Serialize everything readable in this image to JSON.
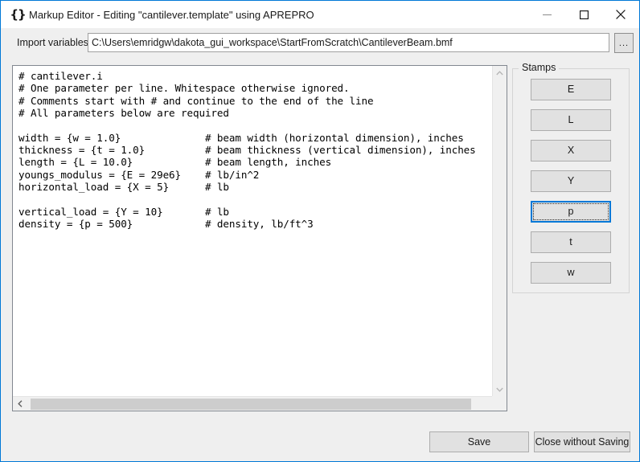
{
  "window": {
    "icon": "braces-icon",
    "title": "Markup Editor - Editing \"cantilever.template\" using APREPRO",
    "controls": {
      "minimize": "minimize-icon",
      "maximize": "maximize-icon",
      "close": "close-icon"
    }
  },
  "import": {
    "label": "Import variables",
    "path_value": "C:\\Users\\emridgw\\dakota_gui_workspace\\StartFromScratch\\CantileverBeam.bmf",
    "path_placeholder": "",
    "browse_label": "..."
  },
  "editor": {
    "content": "# cantilever.i\n# One parameter per line. Whitespace otherwise ignored.\n# Comments start with # and continue to the end of the line\n# All parameters below are required\n\nwidth = {w = 1.0}              # beam width (horizontal dimension), inches\nthickness = {t = 1.0}          # beam thickness (vertical dimension), inches\nlength = {L = 10.0}            # beam length, inches\nyoungs_modulus = {E = 29e6}    # lb/in^2\nhorizontal_load = {X = 5}      # lb\n\nvertical_load = {Y = 10}       # lb\ndensity = {p = 500}            # density, lb/ft^3",
    "vscroll_up": "scroll-up-icon",
    "vscroll_down": "scroll-down-icon",
    "hscroll_left": "scroll-left-icon",
    "hscroll_right": "scroll-right-icon"
  },
  "stamps": {
    "legend": "Stamps",
    "buttons": [
      {
        "label": "E",
        "focused": false
      },
      {
        "label": "L",
        "focused": false
      },
      {
        "label": "X",
        "focused": false
      },
      {
        "label": "Y",
        "focused": false
      },
      {
        "label": "p",
        "focused": true
      },
      {
        "label": "t",
        "focused": false
      },
      {
        "label": "w",
        "focused": false
      }
    ]
  },
  "actions": {
    "save_label": "Save",
    "close_without_saving_label": "Close without Saving"
  },
  "colors": {
    "window_border": "#0078d7",
    "focus_accent": "#0078d7",
    "dialog_bg": "#efefef",
    "titlebar_bg": "#ffffff",
    "editor_bg": "#ffffff",
    "button_face": "#e1e1e1"
  }
}
